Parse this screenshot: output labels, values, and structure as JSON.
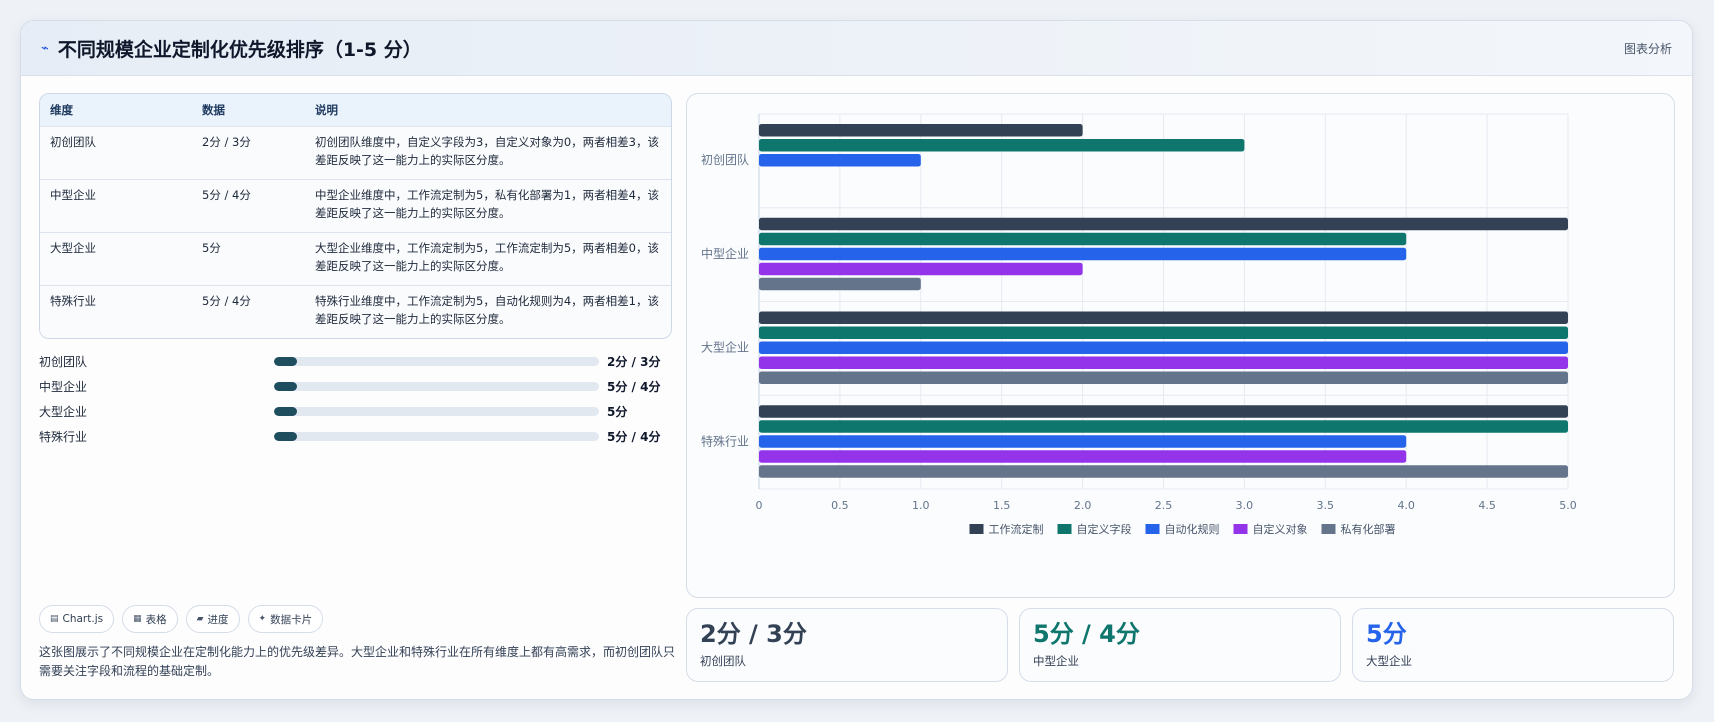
{
  "header": {
    "title": "不同规模企业定制化优先级排序（1-5 分）",
    "right_link": "图表分析"
  },
  "table": {
    "columns": [
      "维度",
      "数据",
      "说明"
    ],
    "rows": [
      {
        "dim": "初创团队",
        "data": "2分 / 3分",
        "note": "初创团队维度中，自定义字段为3，自定义对象为0，两者相差3，该差距反映了这一能力上的实际区分度。"
      },
      {
        "dim": "中型企业",
        "data": "5分 / 4分",
        "note": "中型企业维度中，工作流定制为5，私有化部署为1，两者相差4，该差距反映了这一能力上的实际区分度。"
      },
      {
        "dim": "大型企业",
        "data": "5分",
        "note": "大型企业维度中，工作流定制为5，工作流定制为5，两者相差0，该差距反映了这一能力上的实际区分度。"
      },
      {
        "dim": "特殊行业",
        "data": "5分 / 4分",
        "note": "特殊行业维度中，工作流定制为5，自动化规则为4，两者相差1，该差距反映了这一能力上的实际区分度。"
      }
    ]
  },
  "progress": [
    {
      "label": "初创团队",
      "value": "2分 / 3分",
      "fill_fraction": 0.07
    },
    {
      "label": "中型企业",
      "value": "5分 / 4分",
      "fill_fraction": 0.07
    },
    {
      "label": "大型企业",
      "value": "5分",
      "fill_fraction": 0.07
    },
    {
      "label": "特殊行业",
      "value": "5分 / 4分",
      "fill_fraction": 0.07
    }
  ],
  "chips": [
    {
      "icon": "▤",
      "label": "Chart.js",
      "icon_name": "chart-icon"
    },
    {
      "icon": "▦",
      "label": "表格",
      "icon_name": "table-icon"
    },
    {
      "icon": "▰",
      "label": "进度",
      "icon_name": "progress-icon"
    },
    {
      "icon": "✦",
      "label": "数据卡片",
      "icon_name": "sparkle-icon"
    }
  ],
  "description": "这张图展示了不同规模企业在定制化能力上的优先级差异。大型企业和特殊行业在所有维度上都有高需求，而初创团队只需要关注字段和流程的基础定制。",
  "stats": [
    {
      "value": "2分 / 3分",
      "label": "初创团队",
      "color": "#334155"
    },
    {
      "value": "5分 / 4分",
      "label": "中型企业",
      "color": "#0f766e"
    },
    {
      "value": "5分",
      "label": "大型企业",
      "color": "#2563eb"
    }
  ],
  "chart_data": {
    "type": "bar",
    "orientation": "horizontal",
    "categories": [
      "初创团队",
      "中型企业",
      "大型企业",
      "特殊行业"
    ],
    "series": [
      {
        "name": "工作流定制",
        "color": "#334155",
        "values": [
          2,
          5,
          5,
          5
        ]
      },
      {
        "name": "自定义字段",
        "color": "#0f766e",
        "values": [
          3,
          4,
          5,
          5
        ]
      },
      {
        "name": "自动化规则",
        "color": "#2563eb",
        "values": [
          1,
          4,
          5,
          4
        ]
      },
      {
        "name": "自定义对象",
        "color": "#9333ea",
        "values": [
          0,
          2,
          5,
          4
        ]
      },
      {
        "name": "私有化部署",
        "color": "#64748b",
        "values": [
          0,
          1,
          5,
          5
        ]
      }
    ],
    "xlim": [
      0,
      5
    ],
    "xticks": [
      "0",
      "0.5",
      "1.0",
      "1.5",
      "2.0",
      "2.5",
      "3.0",
      "3.5",
      "4.0",
      "4.5",
      "5.0"
    ],
    "grid": true,
    "legend_position": "bottom"
  }
}
